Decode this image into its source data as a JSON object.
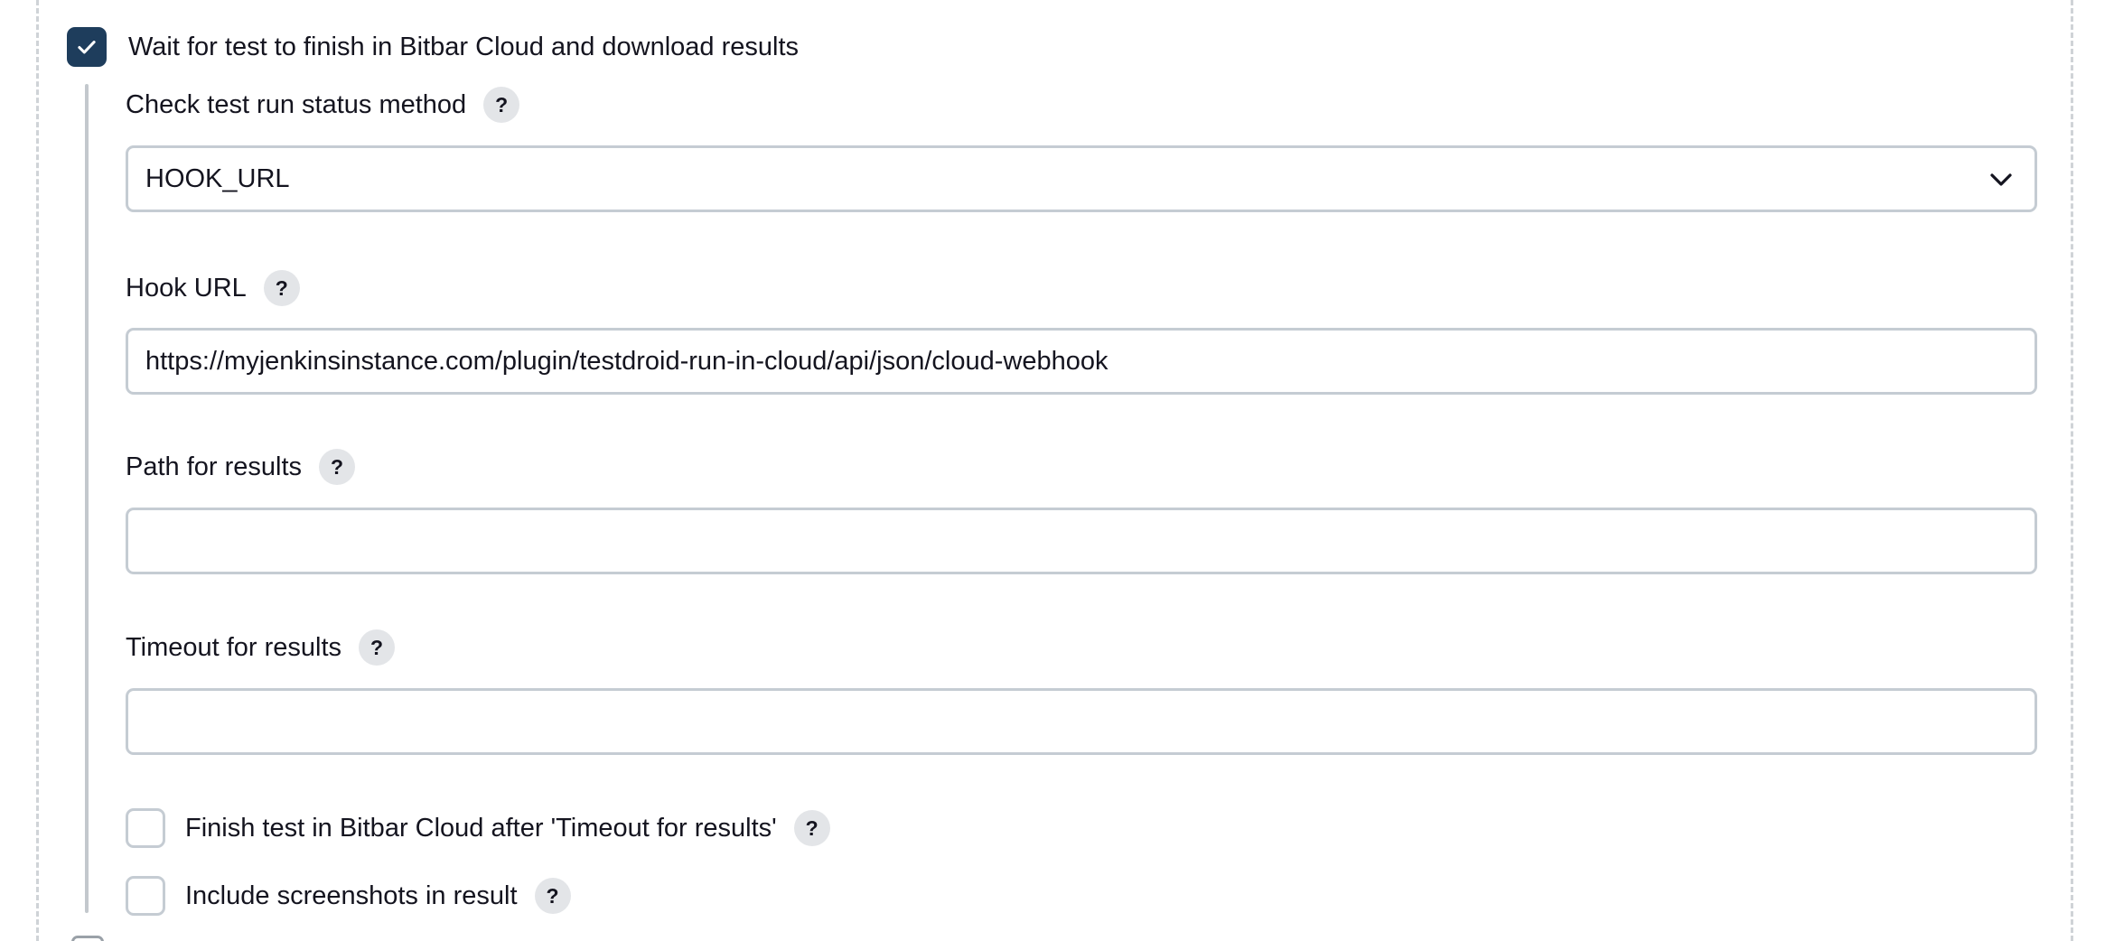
{
  "wait_section": {
    "checkbox_label": "Wait for test to finish in Bitbar Cloud and download results",
    "checked": true
  },
  "status_method": {
    "label": "Check test run status method",
    "help": "?",
    "selected": "HOOK_URL",
    "icon": "chevron-down-icon"
  },
  "hook_url": {
    "label": "Hook URL",
    "help": "?",
    "value": "https://myjenkinsinstance.com/plugin/testdroid-run-in-cloud/api/json/cloud-webhook"
  },
  "results_path": {
    "label": "Path for results",
    "help": "?",
    "value": ""
  },
  "results_timeout": {
    "label": "Timeout for results",
    "help": "?",
    "value": ""
  },
  "finish_after_timeout": {
    "label": "Finish test in Bitbar Cloud after 'Timeout for results'",
    "help": "?",
    "checked": false
  },
  "include_screenshots": {
    "label": "Include screenshots in result",
    "help": "?",
    "checked": false
  },
  "colors": {
    "checkbox_checked": "#1e3d5c",
    "border": "#c5ccd3",
    "help_bg": "#e3e5e8",
    "dashed_border": "#cfd3d7"
  }
}
